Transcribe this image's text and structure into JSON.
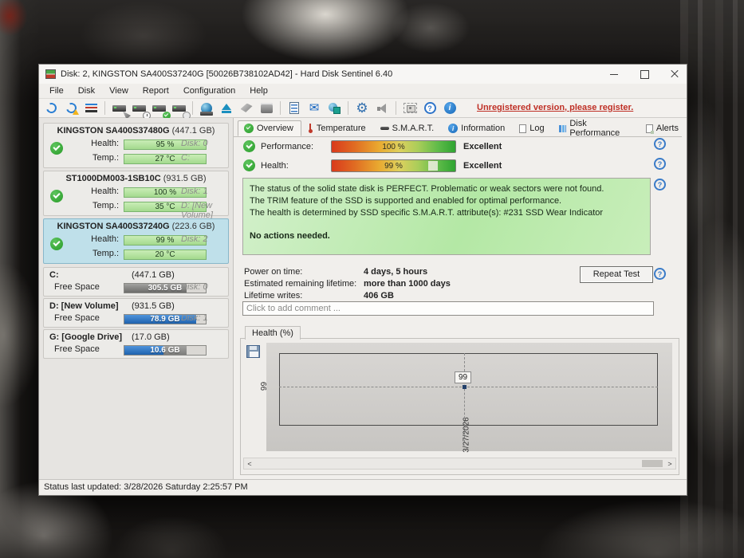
{
  "window": {
    "title": "Disk: 2, KINGSTON SA400S37240G [50026B738102AD42] - Hard Disk Sentinel 6.40"
  },
  "menu": {
    "items": [
      "File",
      "Disk",
      "View",
      "Report",
      "Configuration",
      "Help"
    ]
  },
  "toolbar": {
    "register_link": "Unregistered version, please register.",
    "icons": [
      "refresh",
      "refresh-warning",
      "quick-config",
      "disk-cursor",
      "disk-clock",
      "disk-ok",
      "disk-search",
      "network-drive",
      "eject",
      "surface-tools",
      "hardware-tools",
      "report",
      "email",
      "network-alert",
      "settings-gear",
      "sound",
      "screenshot-camera",
      "help",
      "information"
    ]
  },
  "sidebar": {
    "labels": {
      "health": "Health:",
      "temp": "Temp.:",
      "free": "Free Space"
    },
    "disks": [
      {
        "name": "KINGSTON SA400S37480G",
        "size": "(447.1 GB)",
        "health": "95 %",
        "disk": "Disk: 0",
        "temp": "27 °C",
        "drive": "C:"
      },
      {
        "name": "ST1000DM003-1SB10C",
        "size": "(931.5 GB)",
        "health": "100 %",
        "disk": "Disk: 1",
        "temp": "35 °C",
        "drive": "D: [New Volume]"
      },
      {
        "name": "KINGSTON SA400S37240G",
        "size": "(223.6 GB)",
        "health": "99 %",
        "disk": "Disk: 2",
        "temp": "20 °C",
        "drive": ""
      }
    ],
    "partitions": [
      {
        "name": "C:",
        "size": "(447.1 GB)",
        "free": "305.5 GB",
        "disk": "Disk: 0"
      },
      {
        "name": "D: [New Volume]",
        "size": "(931.5 GB)",
        "free": "78.9 GB",
        "disk": "Disk: 1"
      },
      {
        "name": "G: [Google Drive]",
        "size": "(17.0 GB)",
        "free": "10.6 GB",
        "disk": ""
      }
    ]
  },
  "tabs": [
    {
      "label": "Overview"
    },
    {
      "label": "Temperature"
    },
    {
      "label": "S.M.A.R.T."
    },
    {
      "label": "Information"
    },
    {
      "label": "Log"
    },
    {
      "label": "Disk Performance"
    },
    {
      "label": "Alerts"
    }
  ],
  "overview": {
    "performance_label": "Performance:",
    "performance_value": "100 %",
    "performance_rating": "Excellent",
    "health_label": "Health:",
    "health_value": "99 %",
    "health_rating": "Excellent",
    "status_line1": "The status of the solid state disk is PERFECT. Problematic or weak sectors were not found.",
    "status_line2": "The TRIM feature of the SSD is supported and enabled for optimal performance.",
    "status_line3": "The health is determined by SSD specific S.M.A.R.T. attribute(s):  #231 SSD Wear Indicator",
    "status_action": "No actions needed.",
    "power_on_label": "Power on time:",
    "power_on_value": "4 days, 5 hours",
    "lifetime_label": "Estimated remaining lifetime:",
    "lifetime_value": "more than 1000 days",
    "writes_label": "Lifetime writes:",
    "writes_value": "406 GB",
    "repeat_test_label": "Repeat Test",
    "comment_placeholder": "Click to add comment ..."
  },
  "chart": {
    "panel_title": "Health (%)",
    "y_tick": "99",
    "point_label": "99",
    "x_tick": "3/27/2026"
  },
  "chart_data": {
    "type": "line",
    "title": "Health (%)",
    "x": [
      "3/27/2026"
    ],
    "values": [
      99
    ],
    "ylabel": "Health (%)",
    "ylim": [
      98,
      100
    ],
    "grid": "dashed-crosshair",
    "legend": "none"
  },
  "statusbar": {
    "text": "Status last updated: 3/28/2026 Saturday 2:25:57 PM"
  }
}
